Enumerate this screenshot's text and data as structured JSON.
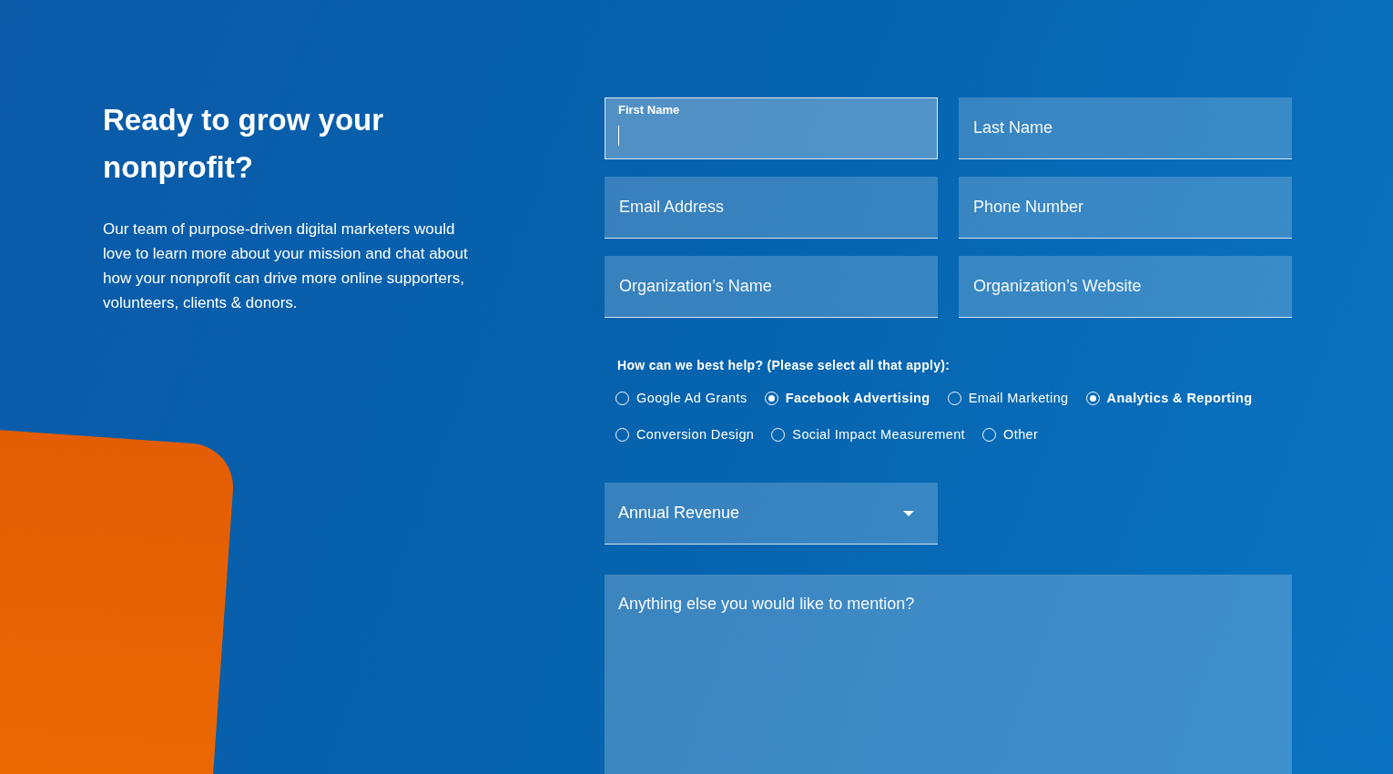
{
  "intro": {
    "heading": "Ready to grow your nonprofit?",
    "body": "Our team of purpose-driven digital marketers would love to learn more about your mission and chat about how your nonprofit can drive more online supporters, volunteers, clients & donors."
  },
  "fields": [
    {
      "placeholder": "First Name",
      "focused": true
    },
    {
      "placeholder": "Last Name",
      "focused": false
    },
    {
      "placeholder": "Email Address",
      "focused": false
    },
    {
      "placeholder": "Phone Number",
      "focused": false
    },
    {
      "placeholder": "Organization’s Name",
      "focused": false
    },
    {
      "placeholder": "Organization’s Website",
      "focused": false
    }
  ],
  "help": {
    "question": "How can we best help? (Please select all that apply):",
    "options": [
      {
        "label": "Google Ad Grants",
        "selected": false
      },
      {
        "label": "Facebook Advertising",
        "selected": true
      },
      {
        "label": "Email Marketing",
        "selected": false
      },
      {
        "label": "Analytics & Reporting",
        "selected": true
      },
      {
        "label": "Conversion Design",
        "selected": false
      },
      {
        "label": "Social Impact Measurement",
        "selected": false
      },
      {
        "label": "Other",
        "selected": false
      }
    ]
  },
  "revenue": {
    "placeholder": "Annual Revenue"
  },
  "message": {
    "placeholder": "Anything else you would like to mention?"
  }
}
